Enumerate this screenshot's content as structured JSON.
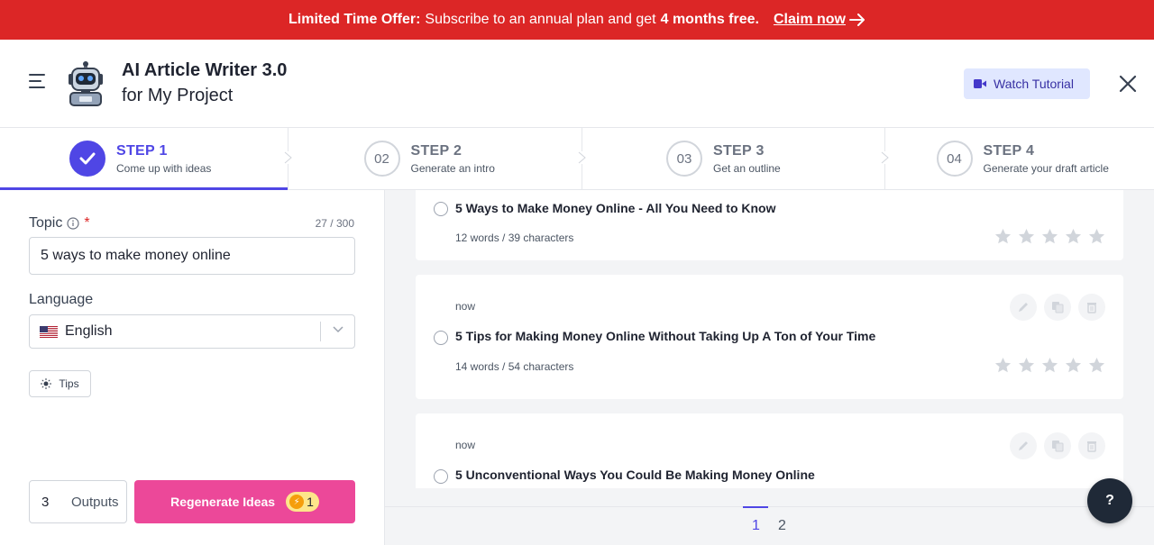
{
  "promo": {
    "prefix": "Limited Time Offer:",
    "text": "Subscribe to an annual plan and get",
    "highlight": "4 months free.",
    "link": "Claim now",
    "color": "#dc2626"
  },
  "header": {
    "title": "AI Article Writer 3.0",
    "subtitle": "for My Project",
    "tutorial_label": "Watch Tutorial"
  },
  "steps": [
    {
      "title": "STEP 1",
      "desc": "Come up with ideas",
      "state": "complete"
    },
    {
      "number": "02",
      "title": "STEP 2",
      "desc": "Generate an intro"
    },
    {
      "number": "03",
      "title": "STEP 3",
      "desc": "Get an outline"
    },
    {
      "number": "04",
      "title": "STEP 4",
      "desc": "Generate your draft article"
    }
  ],
  "form": {
    "topic_label": "Topic",
    "topic_required": "*",
    "topic_counter": "27 / 300",
    "topic_value": "5 ways to make money online",
    "language_label": "Language",
    "language_value": "English",
    "tips_label": "Tips",
    "outputs_value": "3",
    "outputs_label": "Outputs",
    "regenerate_label": "Regenerate Ideas",
    "credit_cost": "1"
  },
  "results": [
    {
      "title": "5 Ways to Make Money Online - All You Need to Know",
      "meta": "12 words / 39 characters",
      "rating": 0
    },
    {
      "time": "now",
      "title": "5 Tips for Making Money Online Without Taking Up A Ton of Your Time",
      "meta": "14 words / 54 characters",
      "rating": 0
    },
    {
      "time": "now",
      "title": "5 Unconventional Ways You Could Be Making Money Online"
    }
  ],
  "pagination": {
    "pages": [
      "1",
      "2"
    ],
    "current": "1"
  },
  "help_label": "?",
  "colors": {
    "accent": "#4f46e5",
    "primary_button": "#ec4899",
    "banner": "#dc2626"
  }
}
